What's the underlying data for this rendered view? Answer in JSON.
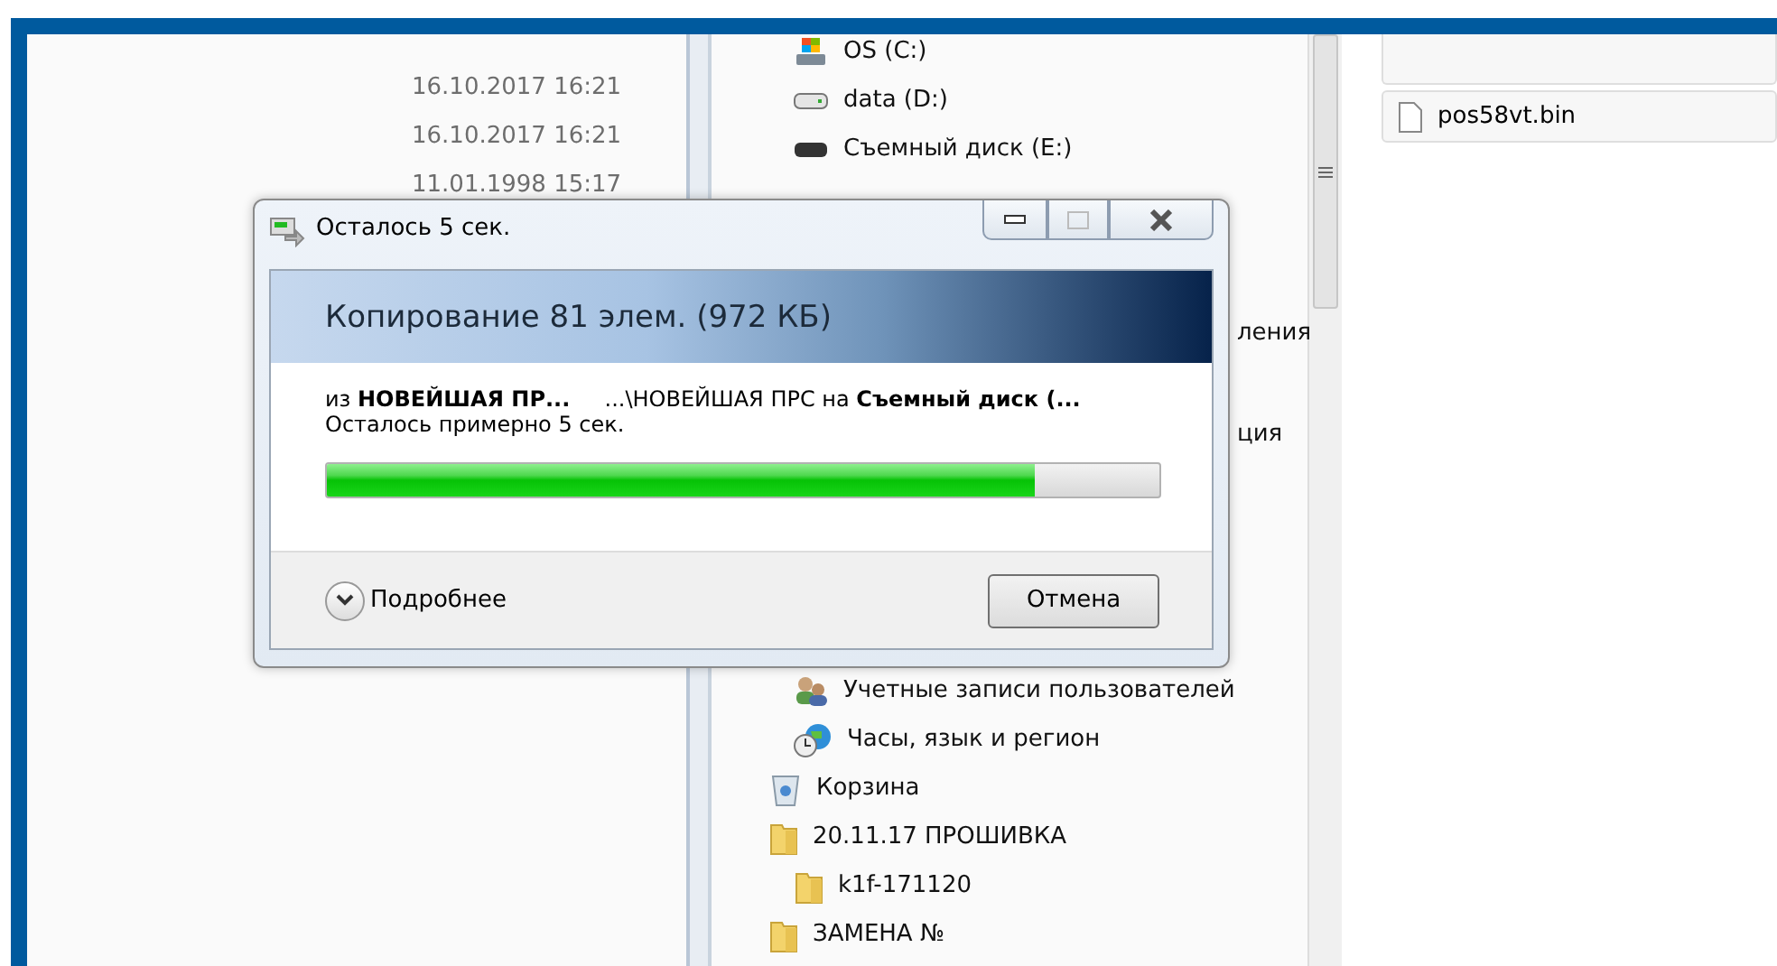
{
  "dates": [
    "16.10.2017 16:21",
    "16.10.2017 16:21",
    "11.01.1998 15:17"
  ],
  "nav": {
    "drives": [
      {
        "label": "OS (C:)",
        "kind": "system"
      },
      {
        "label": "data (D:)",
        "kind": "disk"
      },
      {
        "label": "Съемный диск (E:)",
        "kind": "removable"
      }
    ],
    "fragments": [
      "ления",
      "ция"
    ],
    "items": [
      {
        "label": "Учетные записи пользователей",
        "kind": "users"
      },
      {
        "label": "Часы, язык и регион",
        "kind": "clock"
      },
      {
        "label": "Корзина",
        "kind": "trash",
        "outdent": true
      },
      {
        "label": "20.11.17 ПРОШИВКА",
        "kind": "folder",
        "outdent": true,
        "children": [
          {
            "label": "k1f-171120",
            "kind": "folder"
          }
        ]
      },
      {
        "label": "ЗАМЕНА №",
        "kind": "folder",
        "outdent": true
      }
    ]
  },
  "files": [
    {
      "name": "pos58vt.bin"
    }
  ],
  "dialog": {
    "title": "Осталось 5 сек.",
    "heading": "Копирование 81 элем. (972 КБ)",
    "route": "из **НОВЕЙШАЯ ПР...**     ...\\НОВЕЙШАЯ ПРС на **Съемный диск (...**",
    "remaining": "Осталось примерно 5 сек.",
    "progress": {
      "level": 0.85
    },
    "details": {
      "label": "Подробнее",
      "expanded": false
    },
    "cancel": "Отмена"
  }
}
